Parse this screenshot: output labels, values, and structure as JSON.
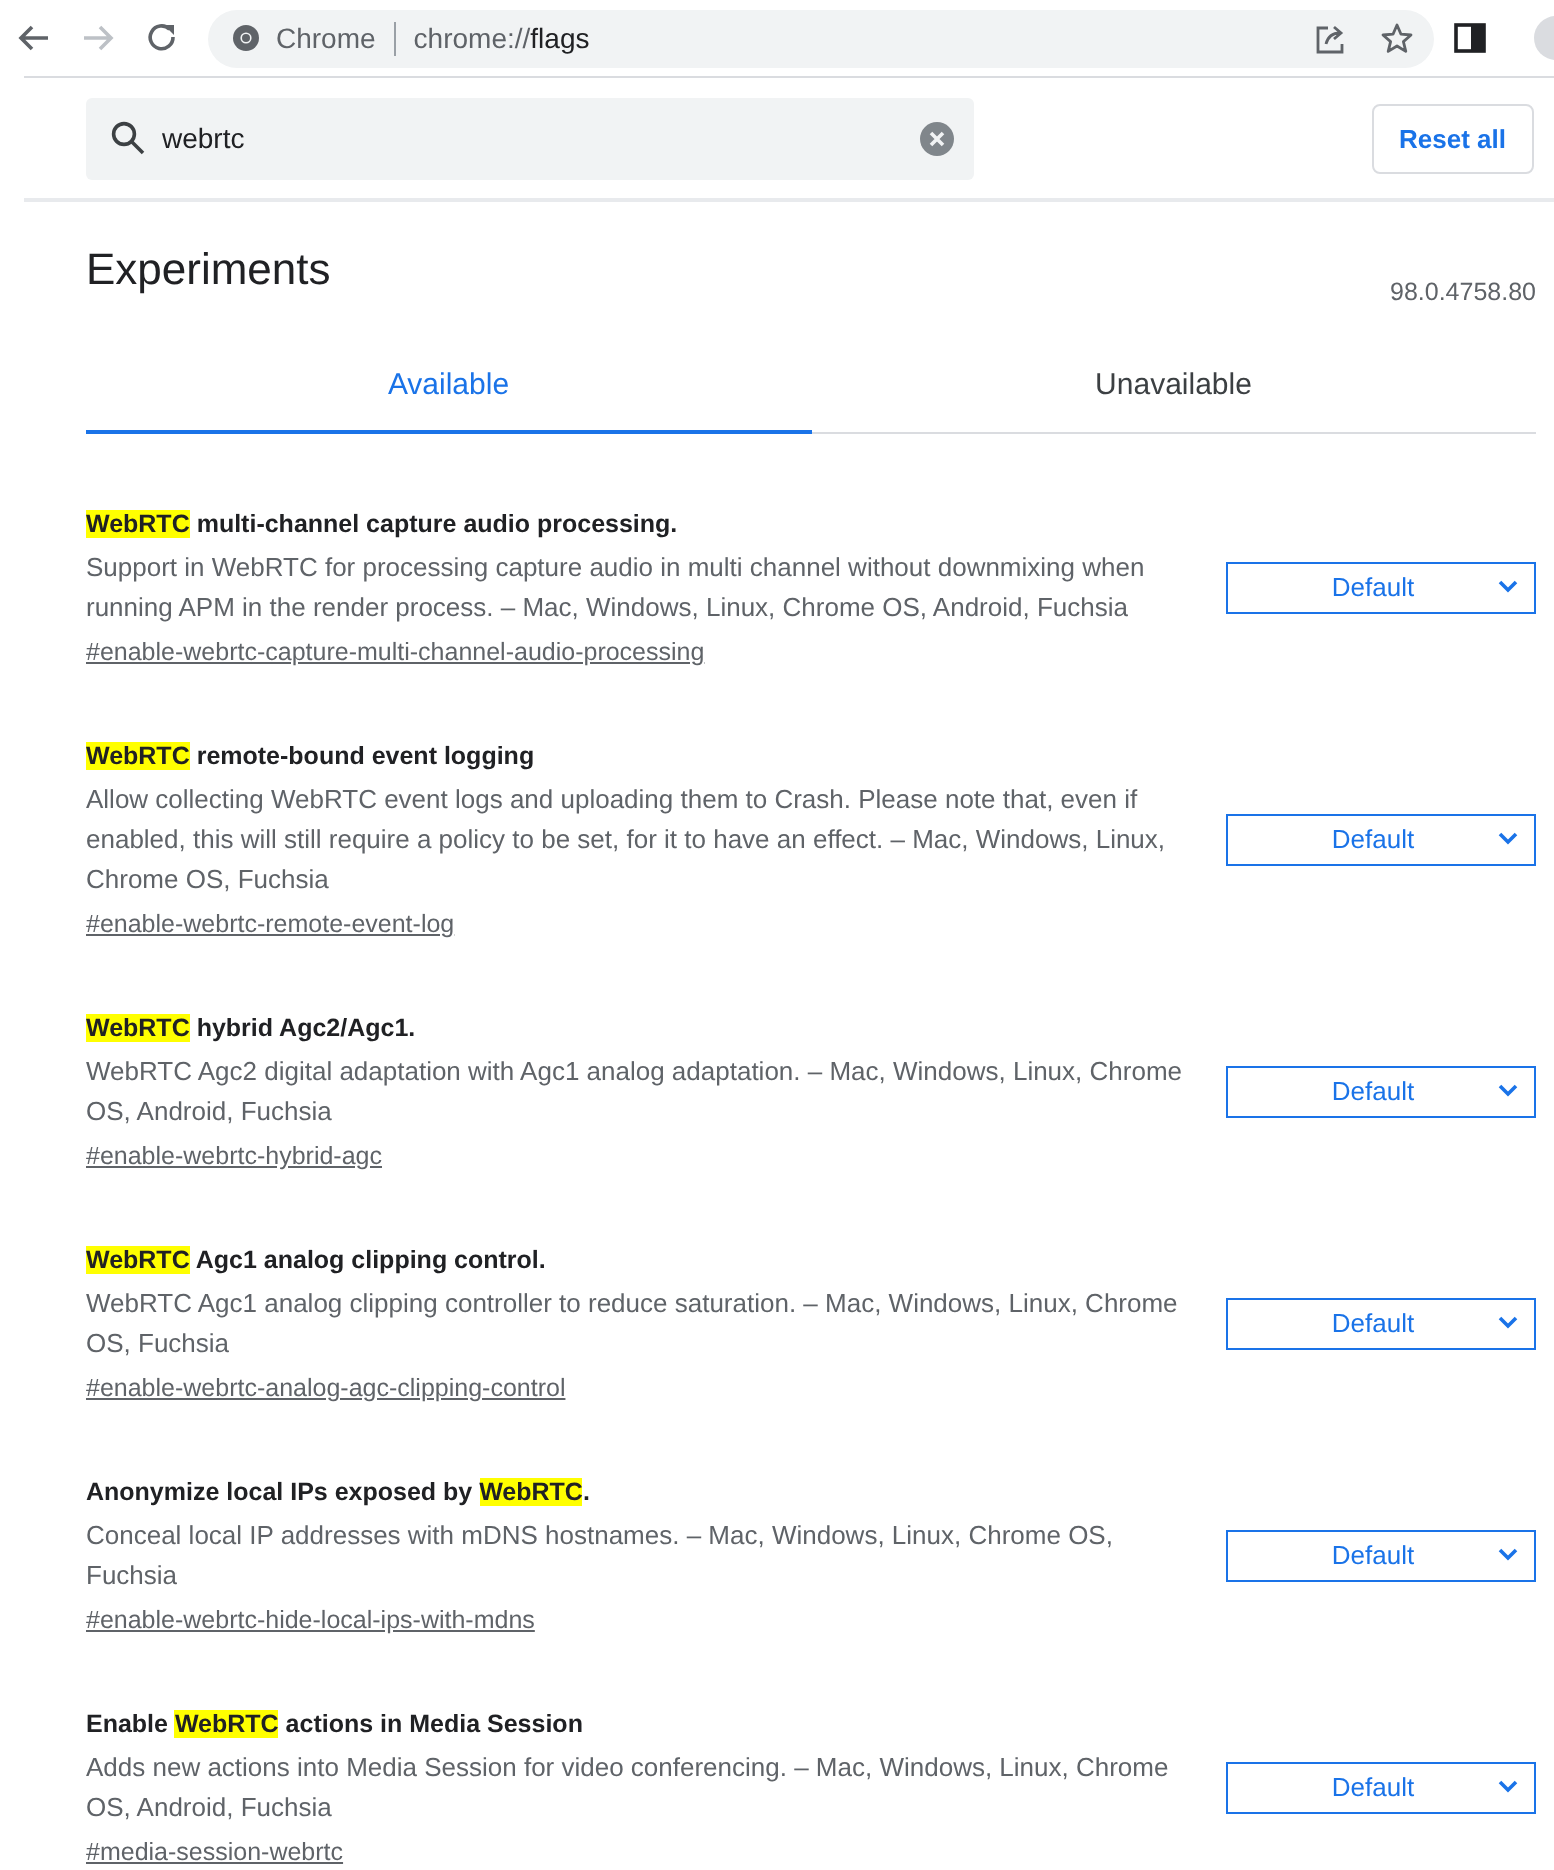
{
  "browser": {
    "omnibox_label": "Chrome",
    "url_scheme": "chrome://",
    "url_path": "flags"
  },
  "search": {
    "value": "webrtc"
  },
  "reset_button": "Reset all",
  "title": "Experiments",
  "version": "98.0.4758.80",
  "tabs": [
    {
      "label": "Available",
      "selected": true
    },
    {
      "label": "Unavailable",
      "selected": false
    }
  ],
  "flags": [
    {
      "title": [
        {
          "text": "WebRTC",
          "highlight": true
        },
        {
          "text": " multi-channel capture audio processing.",
          "highlight": false
        }
      ],
      "description": "Support in WebRTC for processing capture audio in multi channel without downmixing when running APM in the render process. – Mac, Windows, Linux, Chrome OS, Android, Fuchsia",
      "link": "#enable-webrtc-capture-multi-channel-audio-processing",
      "value": "Default"
    },
    {
      "title": [
        {
          "text": "WebRTC",
          "highlight": true
        },
        {
          "text": " remote-bound event logging",
          "highlight": false
        }
      ],
      "description": "Allow collecting WebRTC event logs and uploading them to Crash. Please note that, even if enabled, this will still require a policy to be set, for it to have an effect. – Mac, Windows, Linux, Chrome OS, Fuchsia",
      "link": "#enable-webrtc-remote-event-log",
      "value": "Default"
    },
    {
      "title": [
        {
          "text": "WebRTC",
          "highlight": true
        },
        {
          "text": " hybrid Agc2/Agc1.",
          "highlight": false
        }
      ],
      "description": "WebRTC Agc2 digital adaptation with Agc1 analog adaptation. – Mac, Windows, Linux, Chrome OS, Android, Fuchsia",
      "link": "#enable-webrtc-hybrid-agc",
      "value": "Default"
    },
    {
      "title": [
        {
          "text": "WebRTC",
          "highlight": true
        },
        {
          "text": " Agc1 analog clipping control.",
          "highlight": false
        }
      ],
      "description": "WebRTC Agc1 analog clipping controller to reduce saturation. – Mac, Windows, Linux, Chrome OS, Fuchsia",
      "link": "#enable-webrtc-analog-agc-clipping-control",
      "value": "Default"
    },
    {
      "title": [
        {
          "text": "Anonymize local IPs exposed by ",
          "highlight": false
        },
        {
          "text": "WebRTC",
          "highlight": true
        },
        {
          "text": ".",
          "highlight": false
        }
      ],
      "description": "Conceal local IP addresses with mDNS hostnames. – Mac, Windows, Linux, Chrome OS, Fuchsia",
      "link": "#enable-webrtc-hide-local-ips-with-mdns",
      "value": "Default"
    },
    {
      "title": [
        {
          "text": "Enable ",
          "highlight": false
        },
        {
          "text": "WebRTC",
          "highlight": true
        },
        {
          "text": " actions in Media Session",
          "highlight": false
        }
      ],
      "description": "Adds new actions into Media Session for video conferencing. – Mac, Windows, Linux, Chrome OS, Android, Fuchsia",
      "link": "#media-session-webrtc",
      "value": "Default"
    }
  ]
}
